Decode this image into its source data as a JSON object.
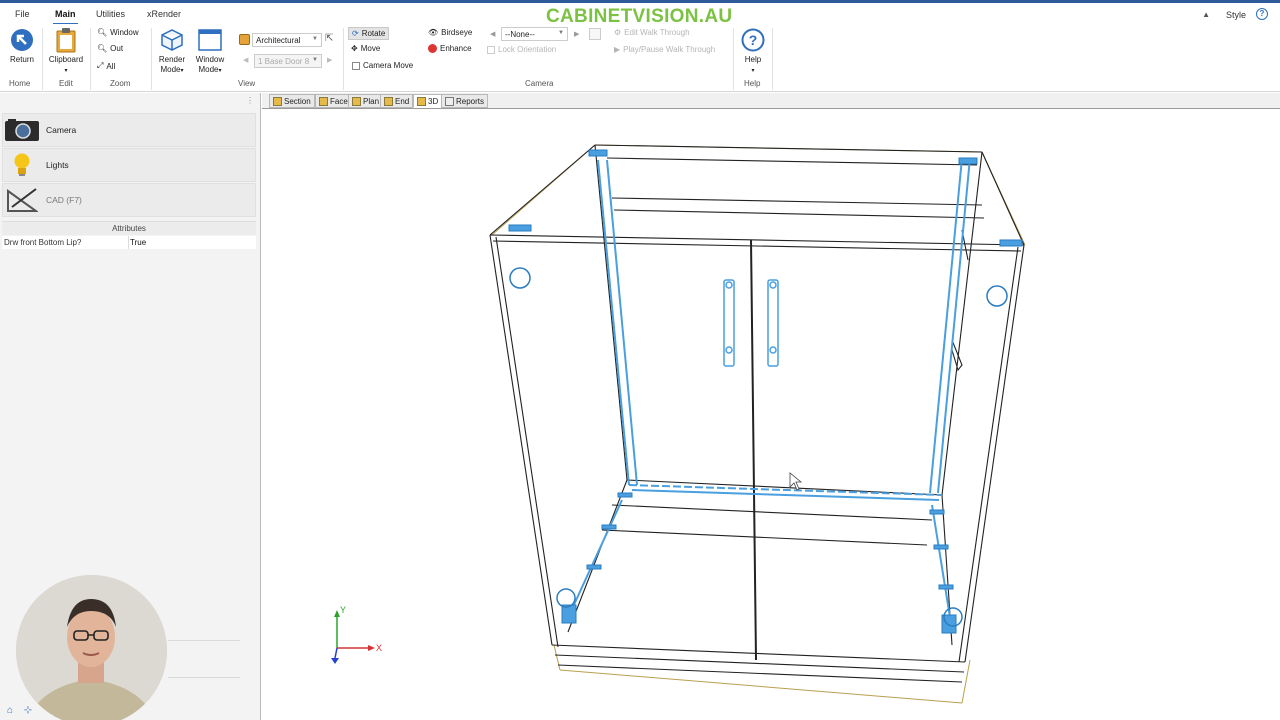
{
  "menu": {
    "tabs": [
      "File",
      "Main",
      "Utilities",
      "xRender"
    ],
    "active_tab": "Main",
    "brand": "CABINETVISION.AU",
    "style_label": "Style"
  },
  "ribbon": {
    "home": {
      "return_label": "Return",
      "group": "Home"
    },
    "edit": {
      "clipboard_label": "Clipboard",
      "group": "Edit"
    },
    "zoom": {
      "window_label": "Window",
      "out_label": "Out",
      "all_label": "All",
      "group": "Zoom"
    },
    "view": {
      "render_mode_line1": "Render",
      "render_mode_line2": "Mode",
      "window_mode_line1": "Window",
      "window_mode_line2": "Mode",
      "style_value": "Architectural",
      "object_value": "1 Base Door 8",
      "group": "View"
    },
    "camera": {
      "rotate_label": "Rotate",
      "move_label": "Move",
      "camera_move_label": "Camera Move",
      "birdseye_label": "Birdseye",
      "enhance_label": "Enhance",
      "preset_value": "--None--",
      "lock_orientation_label": "Lock Orientation",
      "edit_walk_label": "Edit Walk Through",
      "play_walk_label": "Play/Pause Walk Through",
      "group": "Camera"
    },
    "help": {
      "help_label": "Help",
      "group": "Help"
    }
  },
  "left_panel": {
    "items": [
      {
        "label": "Camera",
        "icon": "camera-icon"
      },
      {
        "label": "Lights",
        "icon": "lightbulb-icon"
      },
      {
        "label": "CAD (F7)",
        "icon": "set-square-icon"
      }
    ],
    "attributes_header": "Attributes",
    "attributes": [
      {
        "key": "Drw front Bottom Lip?",
        "value": "True"
      }
    ]
  },
  "view_tabs": [
    "Section",
    "Face",
    "Plan",
    "End",
    "3D",
    "Reports"
  ],
  "active_view_tab": "3D",
  "viewport": {
    "axis_y": "Y",
    "axis_x": "X",
    "colors": {
      "wire": "#222222",
      "hardware": "#4a9fe0",
      "outline": "#b8a050",
      "axis_y": "#2aa52a",
      "axis_x": "#d33333",
      "axis_z": "#2a40d0"
    }
  },
  "colors": {
    "brand": "#7cc242",
    "accent": "#2e6fbf"
  }
}
